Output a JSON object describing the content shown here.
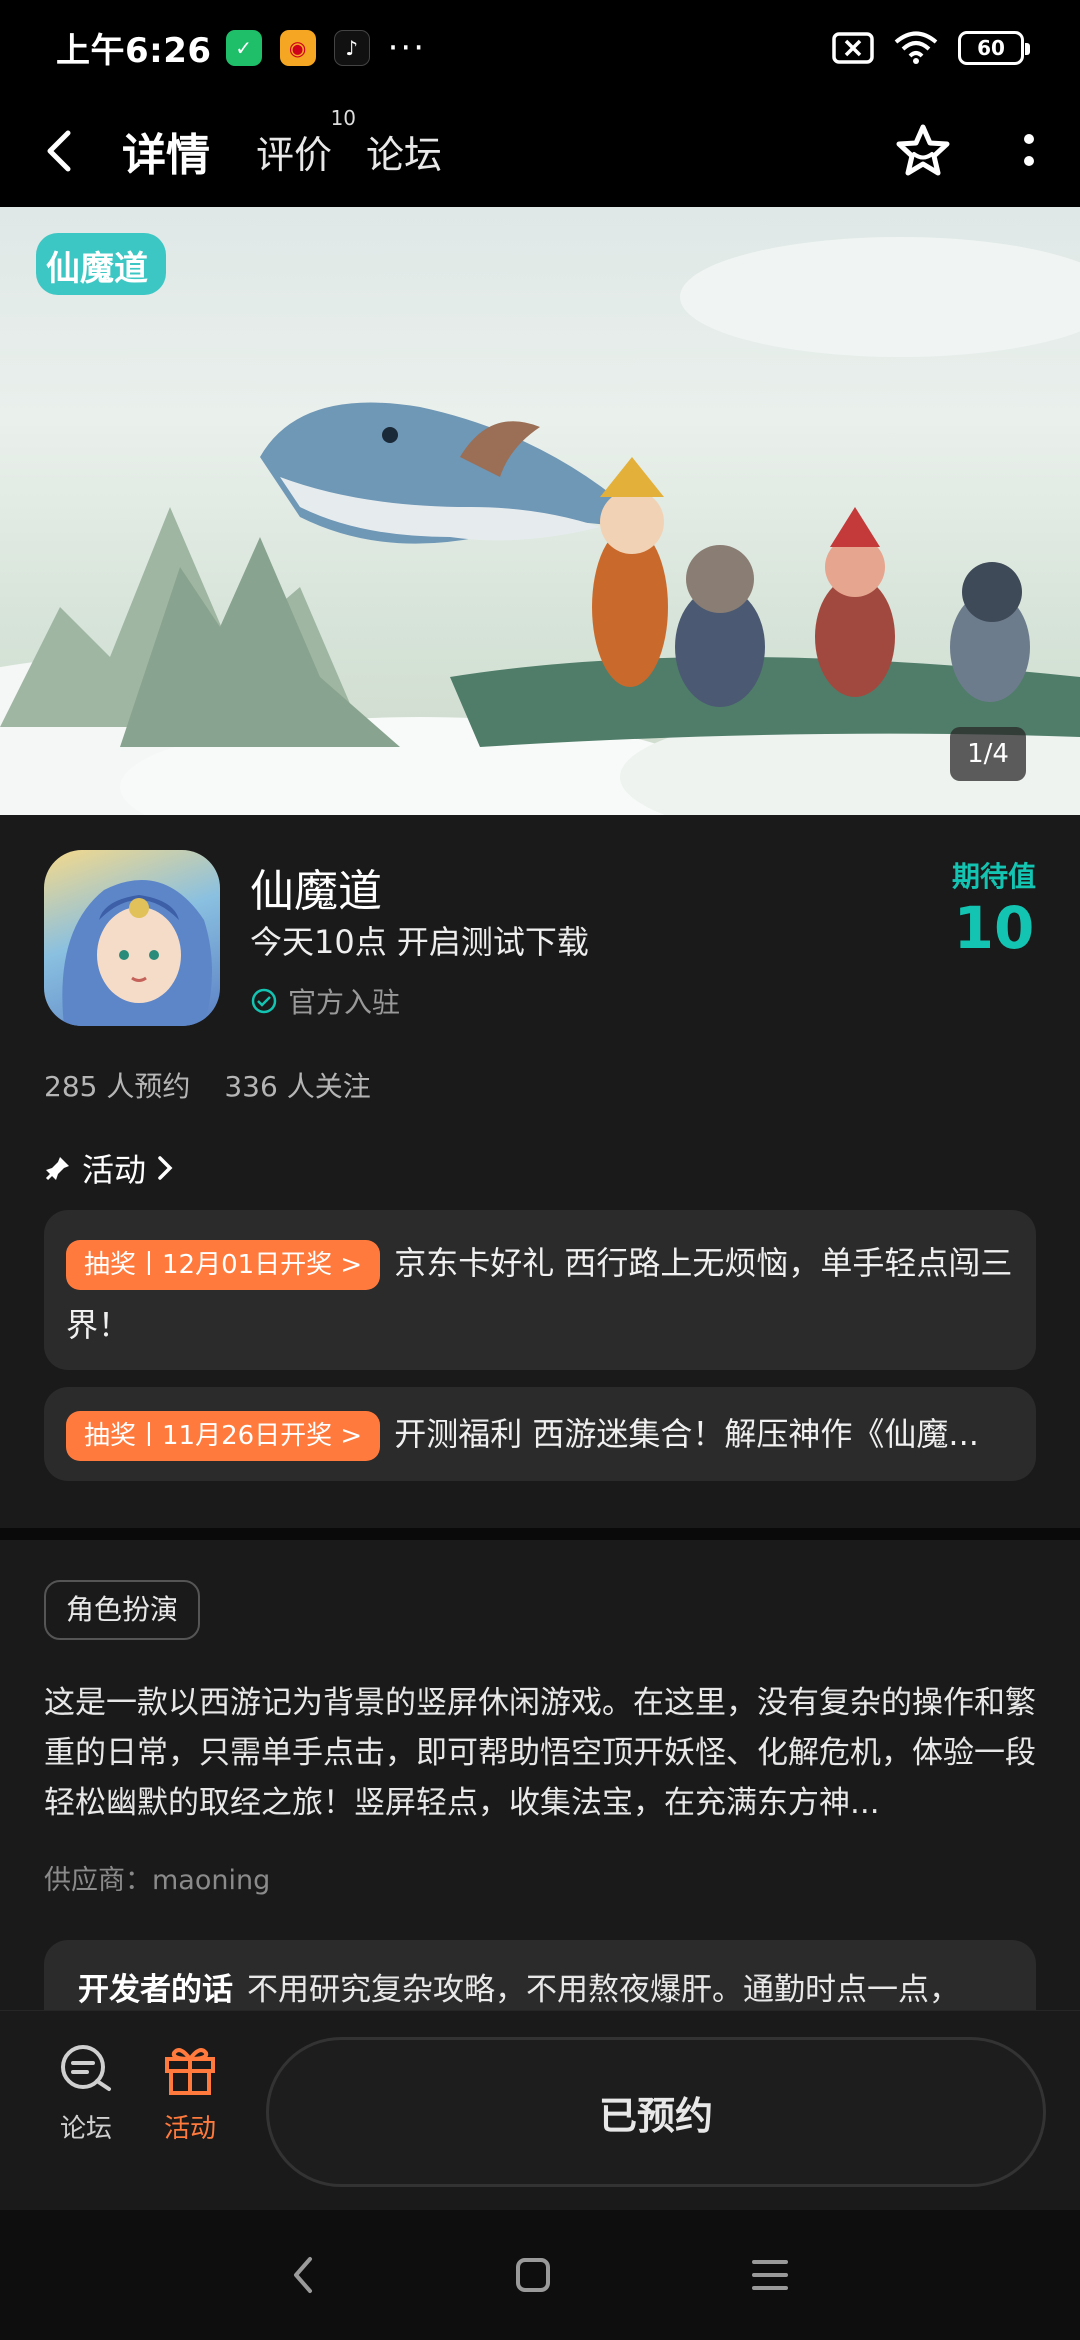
{
  "status_bar": {
    "time": "上午6:26",
    "more": "···",
    "battery": "60"
  },
  "nav": {
    "tabs": [
      {
        "label": "详情",
        "active": true
      },
      {
        "label": "评价",
        "badge": "10"
      },
      {
        "label": "论坛"
      }
    ]
  },
  "banner": {
    "logo_text": "仙魔道",
    "counter": "1/4"
  },
  "app": {
    "name": "仙魔道",
    "subtitle": "今天10点 开启测试下载",
    "official": "官方入驻",
    "expect_label": "期待值",
    "expect_value": "10",
    "reservations": "285 人预约",
    "follows": "336 人关注"
  },
  "activities": {
    "title": "活动",
    "items": [
      {
        "pill": "抽奖丨12月01日开奖 >",
        "text": "京东卡好礼 西行路上无烦恼，单手轻点闯三界！"
      },
      {
        "pill": "抽奖丨11月26日开奖 >",
        "text": "开测福利 西游迷集合！解压神作《仙魔..."
      }
    ]
  },
  "description": {
    "genre": "角色扮演",
    "text": "这是一款以西游记为背景的竖屏休闲游戏。在这里，没有复杂的操作和繁重的日常，只需单手点击，即可帮助悟空顶开妖怪、化解危机，体验一段轻松幽默的取经之旅！竖屏轻点，收集法宝，在充满东方神...",
    "supplier": "供应商：maoning",
    "dev_label": "开发者的话",
    "dev_text": "不用研究复杂攻略，不用熬夜爆肝。通勤时点一点，"
  },
  "bottom_bar": {
    "forum": "论坛",
    "activity": "活动",
    "reserve": "已预约"
  },
  "colors": {
    "accent": "#14c4b2",
    "orange": "#ff7a3c",
    "bg": "#1a1a1a"
  }
}
